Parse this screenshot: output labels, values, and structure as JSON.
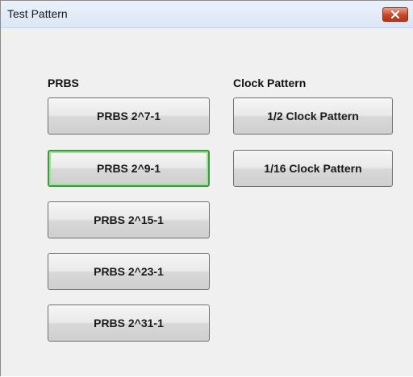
{
  "window": {
    "title": "Test Pattern"
  },
  "prbs_group": {
    "label": "PRBS",
    "buttons": [
      {
        "label": "PRBS 2^7-1"
      },
      {
        "label": "PRBS 2^9-1",
        "focused": true
      },
      {
        "label": "PRBS 2^15-1"
      },
      {
        "label": "PRBS 2^23-1"
      },
      {
        "label": "PRBS 2^31-1"
      }
    ]
  },
  "clock_group": {
    "label": "Clock Pattern",
    "buttons": [
      {
        "label": "1/2 Clock Pattern"
      },
      {
        "label": "1/16 Clock Pattern"
      }
    ]
  },
  "icons": {
    "close": "close-icon"
  },
  "colors": {
    "close_button": "#c5462a",
    "focus_border": "#3c9a3c"
  }
}
